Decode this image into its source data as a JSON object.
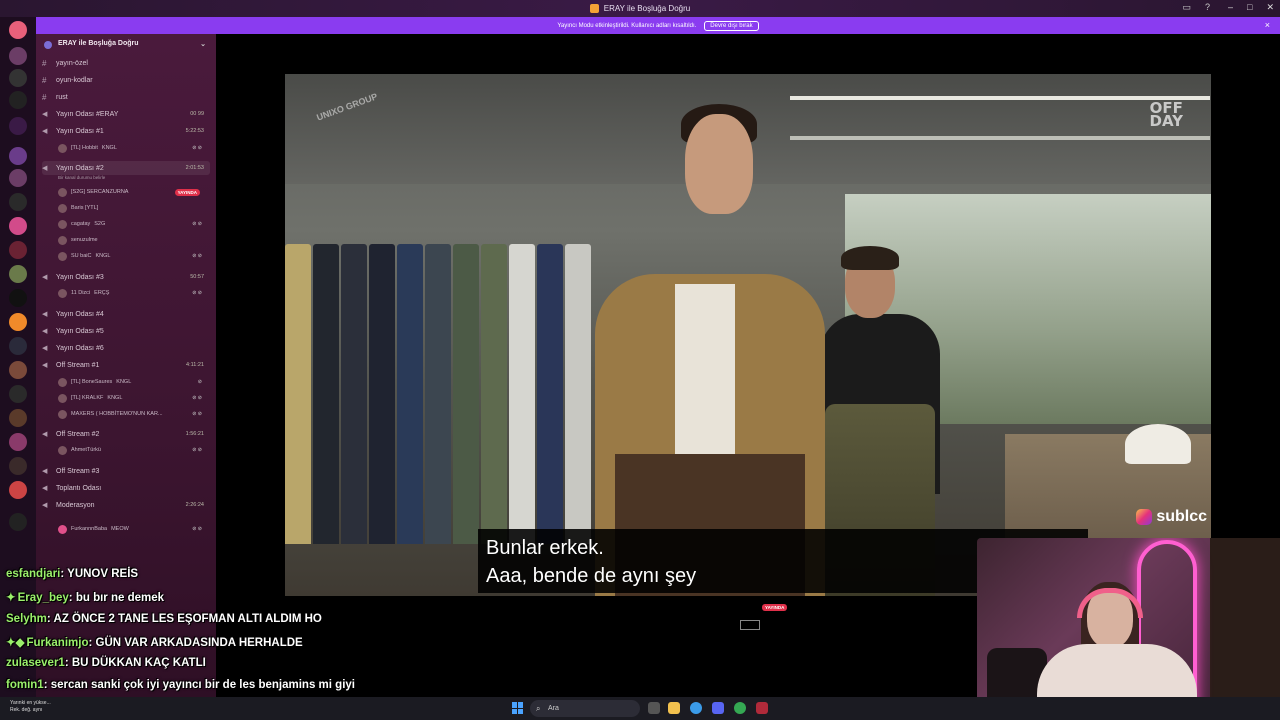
{
  "window": {
    "title": "ERAY ile Boşluğa Doğru"
  },
  "notice": {
    "text": "Yayıncı Modu etkinleştirildi. Kullanıcı adları kısaltıldı.",
    "button": "Devre dışı bırak",
    "close": "×"
  },
  "server": {
    "name": "ERAY ile Boşluğa Doğru"
  },
  "channels": [
    {
      "name": "yayın-özel",
      "type": "text"
    },
    {
      "name": "oyun-kodlar",
      "type": "text"
    },
    {
      "name": "rust",
      "type": "text"
    },
    {
      "name": "Yayın Odası #ERAY",
      "type": "voice",
      "time": "00 99"
    },
    {
      "name": "Yayın Odası #1",
      "type": "voice",
      "time": "5:22:53"
    },
    {
      "name": "Yayın Odası #2",
      "type": "voice",
      "time": "2:01:53"
    },
    {
      "name": "Yayın Odası #3",
      "type": "voice",
      "time": "50:57"
    },
    {
      "name": "Yayın Odası #4",
      "type": "voice"
    },
    {
      "name": "Yayın Odası #5",
      "type": "voice"
    },
    {
      "name": "Yayın Odası #6",
      "type": "voice"
    },
    {
      "name": "Off Stream #1",
      "type": "voice",
      "time": "4:11:21"
    },
    {
      "name": "Off Stream #2",
      "type": "voice",
      "time": "1:56:21"
    },
    {
      "name": "Off Stream #3",
      "type": "voice"
    },
    {
      "name": "Toplantı Odası",
      "type": "voice"
    },
    {
      "name": "Moderasyon",
      "type": "voice",
      "time": "2:26:24"
    }
  ],
  "channel_status": "Bir kanal durumu belirle",
  "users": {
    "room1": [
      {
        "name": "[TL] Hobbit",
        "tag": "KNGL"
      }
    ],
    "room2": [
      {
        "name": "[S2G] SERCANZURNA",
        "live": "YAYINDA"
      },
      {
        "name": "Baris [YTL]"
      },
      {
        "name": "cagatay",
        "tag": "S2G"
      },
      {
        "name": "senuzulme"
      },
      {
        "name": "SU baiC",
        "tag": "KNGL"
      }
    ],
    "room3": [
      {
        "name": "11 Dizci",
        "tag": "ERÇŞ"
      }
    ],
    "off1": [
      {
        "name": "[TL] BoneSaures",
        "tag": "KNGL"
      },
      {
        "name": "[TL] KRALKF",
        "tag": "KNGL"
      },
      {
        "name": "MAXERS ( HOBBİTEMO'NUN KAR..."
      }
    ],
    "off2": [
      {
        "name": "AhmetTürkü"
      }
    ],
    "mod": [
      {
        "name": "FurkannnBaba",
        "tag": "MEOW"
      }
    ]
  },
  "chat": [
    {
      "user": "esfandjari",
      "message": ": YUNOV REİS"
    },
    {
      "user": "Eray_bey",
      "message": ": bu bır ne demek",
      "star": "✦"
    },
    {
      "user": "Selyhm",
      "message": ": AZ ÖNCE 2 TANE LES EŞOFMAN ALTI ALDIM HO"
    },
    {
      "user": "Furkanimjo",
      "message": ": GÜN VAR ARKADASINDA HERHALDE",
      "star": "✦◆"
    },
    {
      "user": "zulasever1",
      "message": ": BU DÜKKAN KAÇ KATLI"
    },
    {
      "user": "fomin1",
      "message": ": sercan sanki çok iyi yayıncı bir de les benjamins mi giyi"
    }
  ],
  "video": {
    "subtitle_line1": "Bunlar erkek.",
    "subtitle_line2": "Aaa, bende de aynı şey",
    "watermark_left": "UNIXO GROUP",
    "watermark_right_1": "OFF",
    "watermark_right_2": "DAY",
    "social_handle": "sublcc"
  },
  "mini_preview": {
    "live": "YAYINDA"
  },
  "taskbar": {
    "search": "Ara",
    "notif_line1": "Yarınki en yükse...",
    "notif_line2": "Rek. değ. aynı"
  }
}
